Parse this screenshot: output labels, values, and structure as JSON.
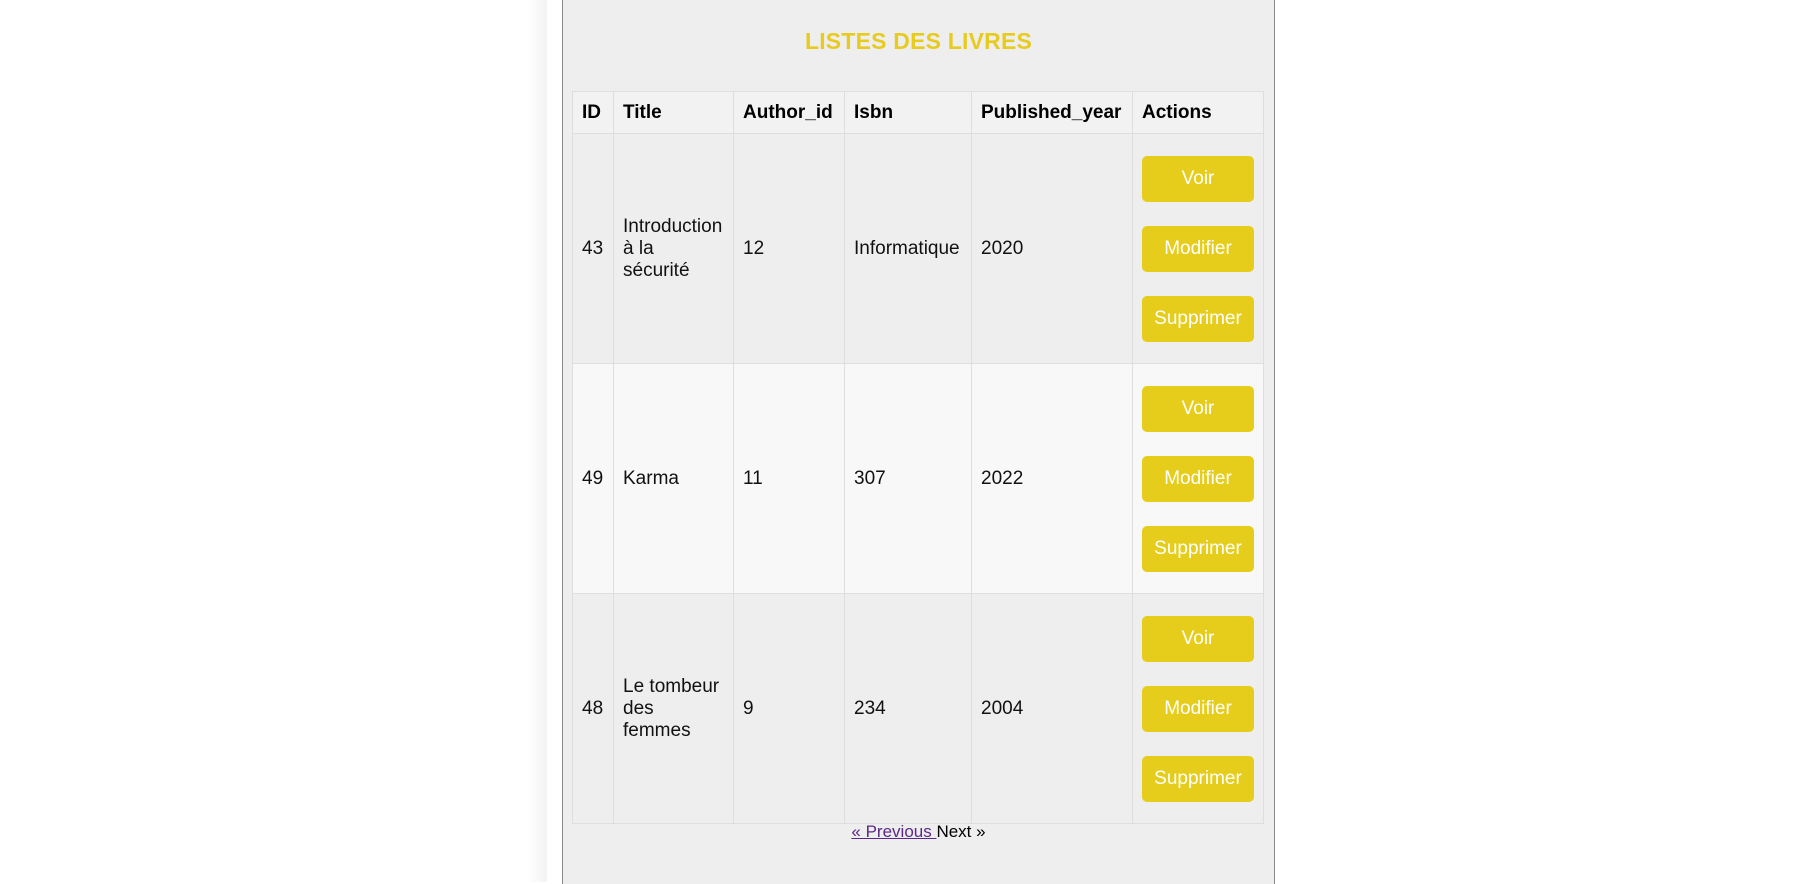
{
  "page": {
    "title": "LISTES DES LIVRES",
    "accent_color": "#e6cd1c"
  },
  "table": {
    "headers": [
      "ID",
      "Title",
      "Author_id",
      "Isbn",
      "Published_year",
      "Actions"
    ],
    "rows": [
      {
        "id": "43",
        "title": "Introduction à la sécurité",
        "author_id": "12",
        "isbn": "Informatique",
        "published_year": "2020"
      },
      {
        "id": "49",
        "title": "Karma",
        "author_id": "11",
        "isbn": "307",
        "published_year": "2022"
      },
      {
        "id": "48",
        "title": "Le tombeur des femmes",
        "author_id": "9",
        "isbn": "234",
        "published_year": "2004"
      }
    ],
    "actions": {
      "view_label": "Voir",
      "edit_label": "Modifier",
      "delete_label": "Supprimer"
    }
  },
  "pagination": {
    "previous_label": "« Previous ",
    "next_label": "Next »"
  }
}
